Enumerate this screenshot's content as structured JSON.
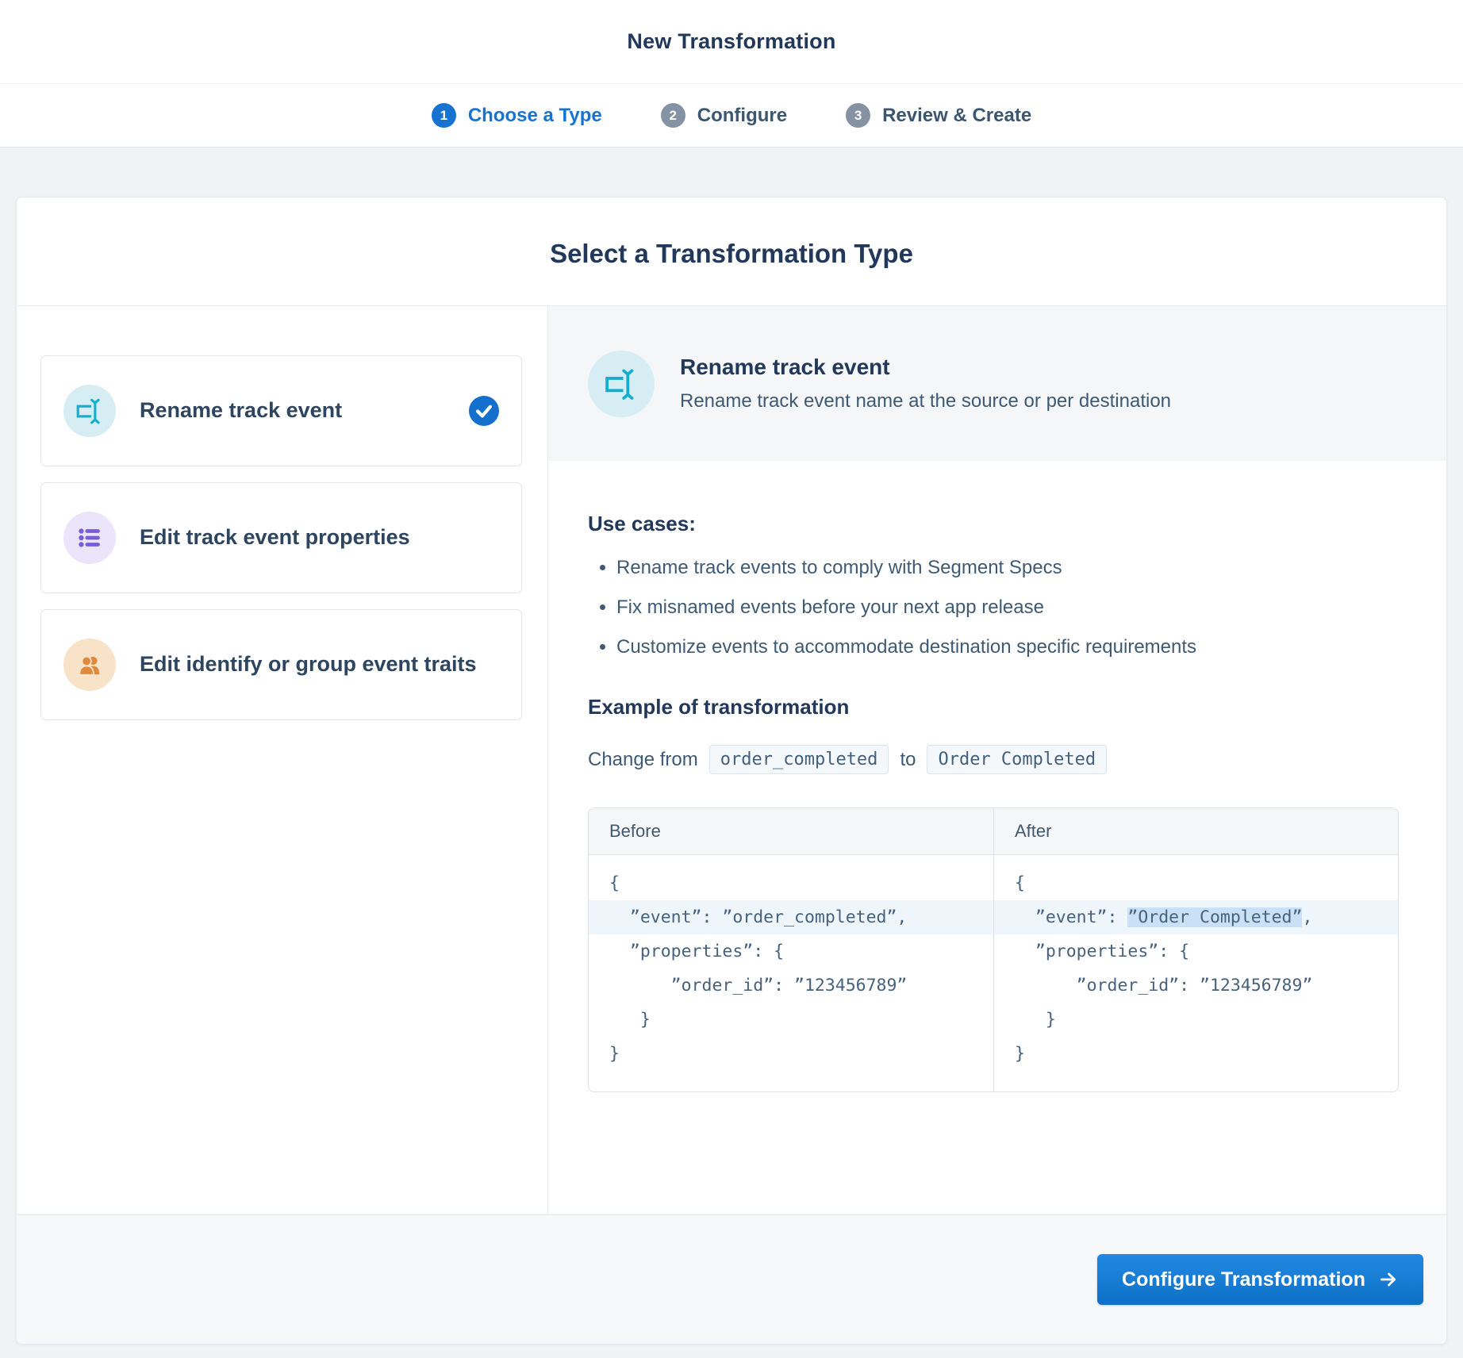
{
  "header": {
    "title": "New Transformation"
  },
  "stepper": {
    "steps": [
      {
        "number": "1",
        "label": "Choose a Type",
        "active": true
      },
      {
        "number": "2",
        "label": "Configure",
        "active": false
      },
      {
        "number": "3",
        "label": "Review & Create",
        "active": false
      }
    ]
  },
  "card": {
    "title": "Select a Transformation Type",
    "options": [
      {
        "label": "Rename track event",
        "icon": "rename-icon",
        "selected": true
      },
      {
        "label": "Edit track event properties",
        "icon": "list-icon",
        "selected": false
      },
      {
        "label": "Edit identify or group event traits",
        "icon": "people-icon",
        "selected": false
      }
    ],
    "detail": {
      "title": "Rename track event",
      "description": "Rename track event name at the source or per destination",
      "use_cases_heading": "Use cases:",
      "use_cases": [
        "Rename track events to comply with Segment Specs",
        "Fix misnamed events before your next app release",
        "Customize events to accommodate destination specific requirements"
      ],
      "example_heading": "Example of transformation",
      "change_prefix": "Change from",
      "change_from_code": "order_completed",
      "change_connector": "to",
      "change_to_code": "Order Completed",
      "comparison": {
        "before_label": "Before",
        "after_label": "After",
        "before_lines": {
          "l0": "{",
          "l1": "  ”event”: ”order_completed”,",
          "l2": "  ”properties”: {",
          "l3": "      ”order_id”: ”123456789”",
          "l4": "   }",
          "l5": "}"
        },
        "after_lines": {
          "l0": "{",
          "l1_pre": "  ”event”: ",
          "l1_highlight": "”Order Completed”",
          "l1_post": ",",
          "l2": "  ”properties”: {",
          "l3": "      ”order_id”: ”123456789”",
          "l4": "   }",
          "l5": "}"
        }
      }
    },
    "footer": {
      "button_label": "Configure Transformation"
    }
  },
  "colors": {
    "accent_blue": "#1673d2",
    "teal_icon": "#17aecd",
    "purple_icon": "#7a5cdb",
    "orange_icon": "#dd8a3e",
    "highlight_row": "#eef5fb",
    "highlight_value": "#c9e0f5"
  }
}
